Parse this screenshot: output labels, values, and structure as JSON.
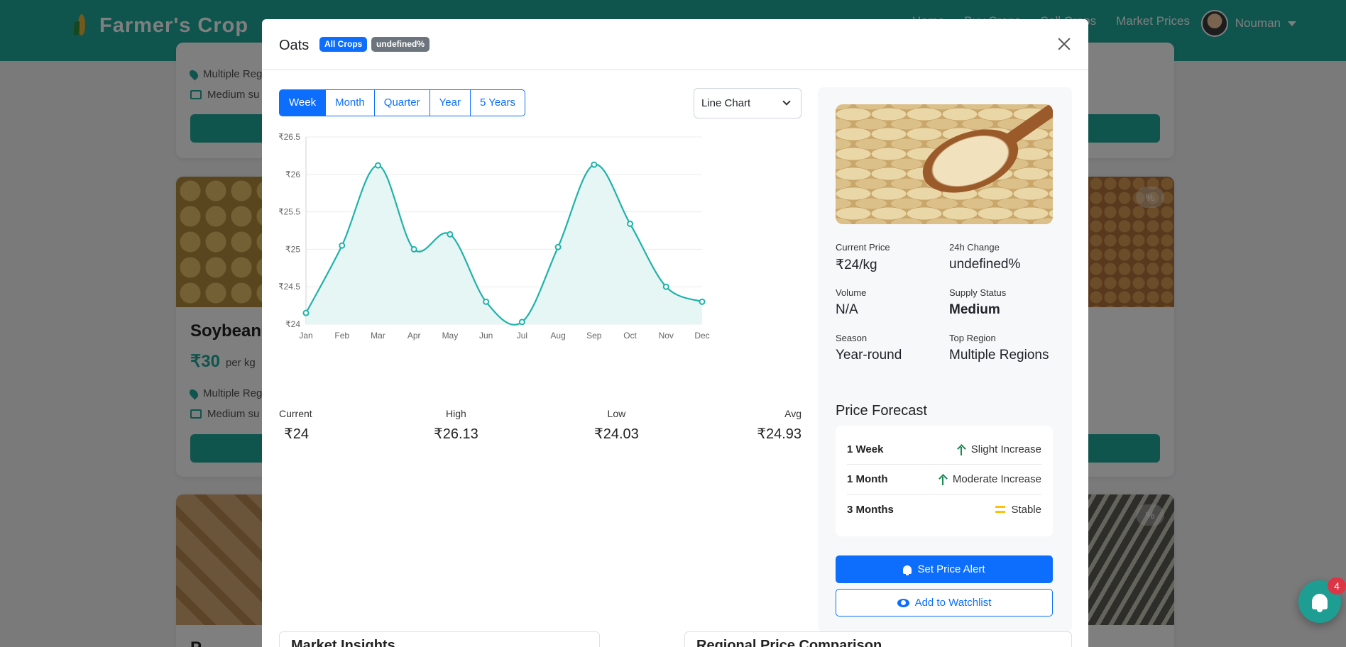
{
  "background": {
    "brand": "Farmer's Crop",
    "nav_links": [
      "Home",
      "Buy Crops",
      "Sell Crops",
      "Market Prices"
    ],
    "user_name": "Nouman",
    "cards": [
      {
        "meta_region": "Multiple Reg",
        "meta_supply": "Medium su"
      },
      {
        "title": "Soybean",
        "price": "₹30",
        "unit": "per kg",
        "meta_region": "Multiple Reg",
        "meta_supply": "Medium su"
      },
      {
        "title": "P"
      }
    ],
    "pct_chip": "%",
    "notification_count": "4"
  },
  "modal": {
    "title": "Oats",
    "badge_category": "All Crops",
    "badge_change": "undefined%",
    "periods": [
      "Week",
      "Month",
      "Quarter",
      "Year",
      "5 Years"
    ],
    "active_period": "Week",
    "chart_type_select": "Line Chart",
    "stats": [
      {
        "label": "Current",
        "value": "₹24"
      },
      {
        "label": "High",
        "value": "₹26.13"
      },
      {
        "label": "Low",
        "value": "₹24.03"
      },
      {
        "label": "Avg",
        "value": "₹24.93"
      }
    ],
    "details": {
      "current_price_label": "Current Price",
      "current_price": "₹24/kg",
      "change_label": "24h Change",
      "change": "undefined%",
      "volume_label": "Volume",
      "volume": "N/A",
      "supply_label": "Supply Status",
      "supply": "Medium",
      "season_label": "Season",
      "season": "Year-round",
      "region_label": "Top Region",
      "region": "Multiple Regions"
    },
    "forecast": {
      "title": "Price Forecast",
      "rows": [
        {
          "period": "1 Week",
          "trend": "Slight Increase",
          "icon": "arrow-up-icon"
        },
        {
          "period": "1 Month",
          "trend": "Moderate Increase",
          "icon": "arrow-up-icon"
        },
        {
          "period": "3 Months",
          "trend": "Stable",
          "icon": "equals-icon"
        }
      ]
    },
    "buttons": {
      "set_alert": "Set Price Alert",
      "watchlist": "Add to Watchlist"
    },
    "bottom_sections": [
      "Market Insights",
      "Regional Price Comparison"
    ]
  },
  "colors": {
    "brand": "#20a99c",
    "primary": "#0d6efd",
    "line": "#20b2aa",
    "fill": "#e6f6f4"
  },
  "chart_data": {
    "type": "area",
    "categories": [
      "Jan",
      "Feb",
      "Mar",
      "Apr",
      "May",
      "Jun",
      "Jul",
      "Aug",
      "Sep",
      "Oct",
      "Nov",
      "Dec"
    ],
    "values": [
      24.15,
      25.05,
      26.12,
      25.0,
      25.2,
      24.3,
      24.03,
      25.03,
      26.13,
      25.34,
      24.5,
      24.3
    ],
    "ylim": [
      24,
      26.5
    ],
    "yticks": [
      "₹24",
      "₹24.5",
      "₹25",
      "₹25.5",
      "₹26",
      "₹26.5"
    ],
    "grid": true,
    "legend": "none"
  }
}
